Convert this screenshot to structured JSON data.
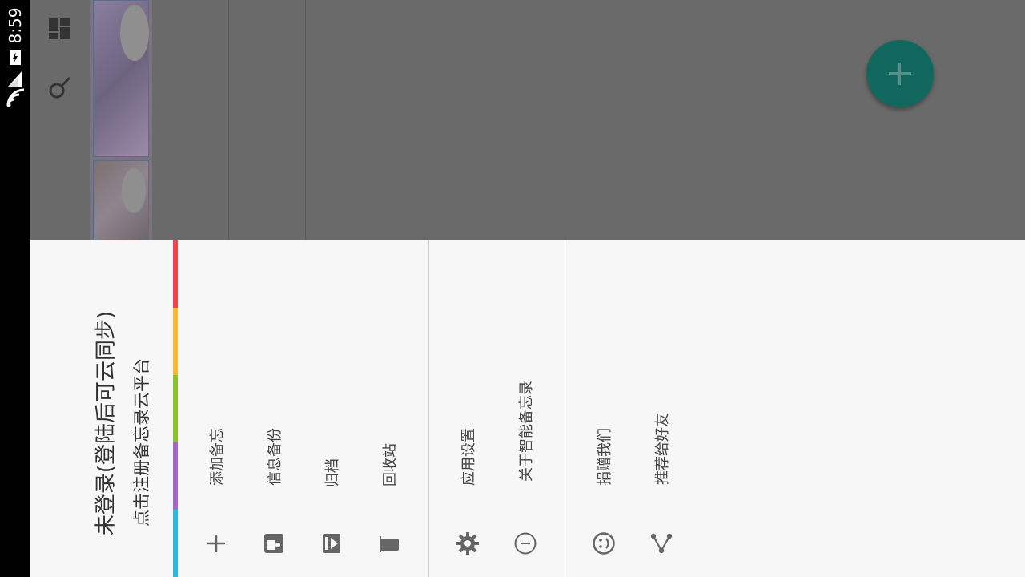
{
  "status_bar": {
    "time": "8:59",
    "icons": [
      "battery-charging-icon",
      "signal-icon",
      "wifi-icon"
    ]
  },
  "background": {
    "toolbar_icons": [
      "dashboard-icon",
      "search-icon"
    ],
    "fab_icon": "plus-icon"
  },
  "drawer": {
    "header": {
      "title": "未登录(登陆后可云同步)",
      "subtitle": "点击注册备忘录云平台"
    },
    "accent_colors": [
      "#f44344",
      "#fbb633",
      "#8bc42a",
      "#a766cc",
      "#2db7e1"
    ],
    "sections": [
      {
        "items": [
          {
            "label": "添加备忘",
            "icon": "plus-icon"
          },
          {
            "label": "信息备份",
            "icon": "backup-icon"
          },
          {
            "label": "归档",
            "icon": "archive-icon"
          },
          {
            "label": "回收站",
            "icon": "trash-icon"
          }
        ]
      },
      {
        "items": [
          {
            "label": "应用设置",
            "icon": "gear-icon"
          },
          {
            "label": "关于智能备忘录",
            "icon": "info-icon"
          }
        ]
      },
      {
        "items": [
          {
            "label": "捐赠我们",
            "icon": "smiley-icon"
          },
          {
            "label": "推荐给好友",
            "icon": "share-icon"
          }
        ]
      }
    ]
  }
}
